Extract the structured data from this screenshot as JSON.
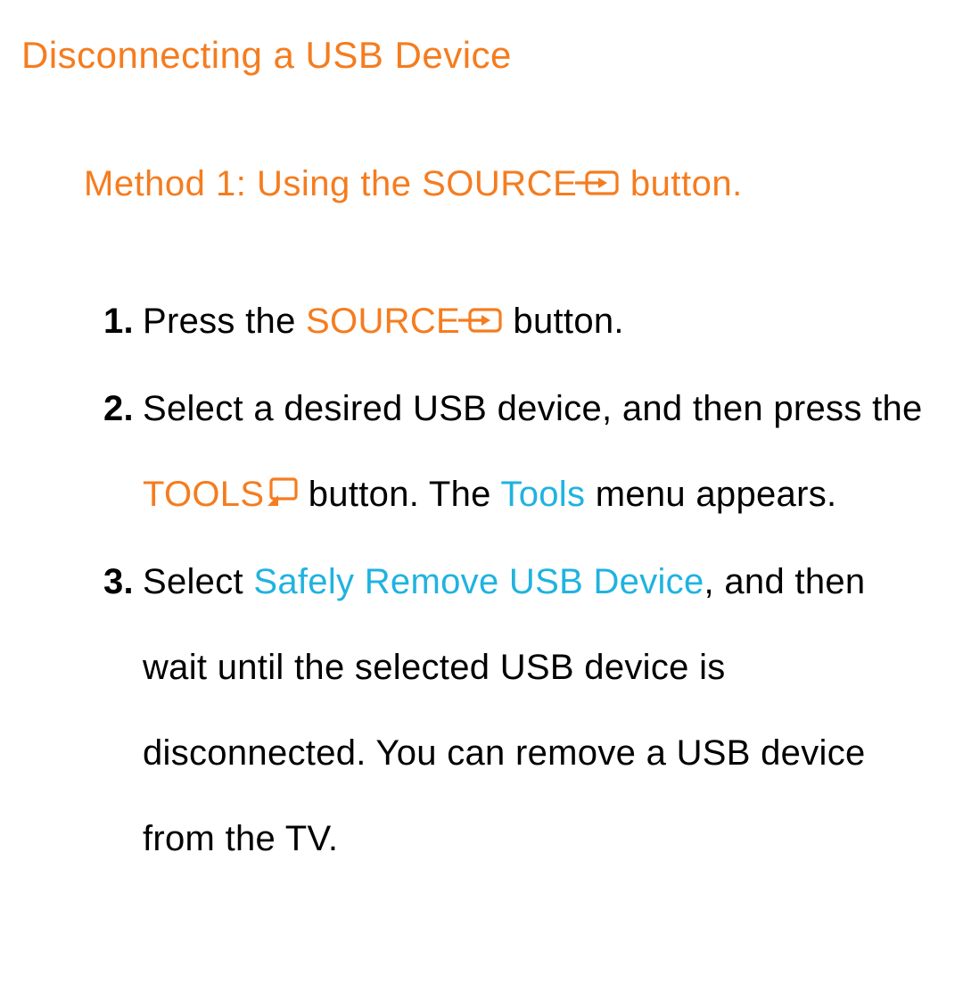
{
  "title": "Disconnecting a USB Device",
  "method_heading_pre": "Method 1: Using the ",
  "method_heading_source": "SOURCE",
  "method_heading_post": " button.",
  "steps": {
    "s1": {
      "num": "1.",
      "pre": "Press the ",
      "source": "SOURCE",
      "post": " button."
    },
    "s2": {
      "num": "2.",
      "pre": "Select a desired USB device, and then press the ",
      "tools": "TOOLS",
      "mid": " button. The ",
      "tools_menu": "Tools",
      "post": " menu appears."
    },
    "s3": {
      "num": "3.",
      "pre": "Select ",
      "safe": "Safely Remove USB Device",
      "post": ", and then wait until the selected USB device is disconnected. You can remove a USB device from the TV."
    }
  }
}
